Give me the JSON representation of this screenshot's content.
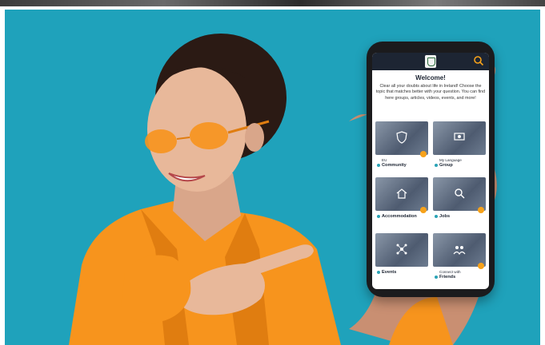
{
  "phone": {
    "header": {
      "logo_icon": "crest-logo-icon",
      "search_icon": "search-icon"
    },
    "welcome_title": "Welcome!",
    "intro_text": "Clear all your doubts about life in Ireland! Choose the topic that matches better with your question. You can find here groups, articles, videos, events, and more!",
    "tiles": [
      {
        "small": "EU",
        "label": "Community",
        "icon": "shield-icon"
      },
      {
        "small": "My Language",
        "label": "Group",
        "icon": "people-icon"
      },
      {
        "small": "",
        "label": "Accommodation",
        "icon": "house-icon"
      },
      {
        "small": "",
        "label": "Jobs",
        "icon": "magnifier-icon"
      },
      {
        "small": "",
        "label": "Events",
        "icon": "network-icon"
      },
      {
        "small": "Connect with",
        "label": "Friends",
        "icon": "friends-icon"
      }
    ]
  },
  "colors": {
    "background": "#1fa2bb",
    "jacket": "#f7941d",
    "accent_dot": "#f7a21a",
    "app_header": "#1d2533"
  }
}
